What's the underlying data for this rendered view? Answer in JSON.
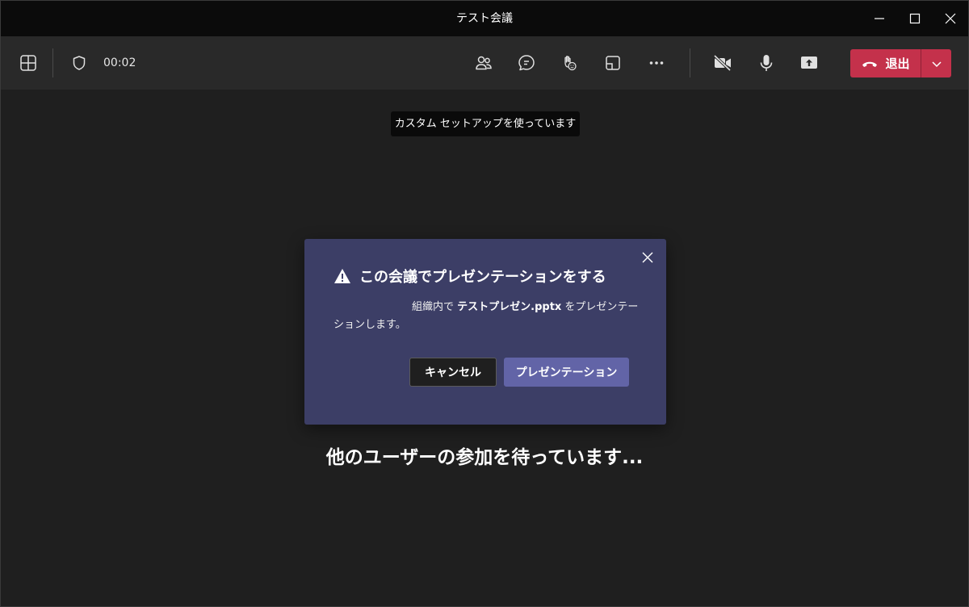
{
  "window": {
    "title": "テスト会議"
  },
  "toolbar": {
    "timer": "00:02",
    "leave_label": "退出"
  },
  "tooltip": {
    "text": "カスタム セットアップを使っています"
  },
  "dialog": {
    "title": "この会議でプレゼンテーションをする",
    "body_prefix": "組織内で ",
    "file_name": "テストプレゼン.pptx",
    "body_suffix": " をプレゼンテーションします。",
    "cancel_label": "キャンセル",
    "present_label": "プレゼンテーション"
  },
  "stage": {
    "waiting_text": "他のユーザーの参加を待っています..."
  },
  "colors": {
    "leave": "#c4314b",
    "primary": "#6264a7",
    "dialog_bg": "#3c3e66",
    "toolbar_bg": "#292929",
    "stage_bg": "#1f1f1f"
  },
  "icons": [
    "layout-grid-icon",
    "shield-icon",
    "people-icon",
    "chat-icon",
    "raise-hand-icon",
    "rooms-icon",
    "more-icon",
    "camera-off-icon",
    "microphone-icon",
    "share-screen-icon",
    "phone-hangup-icon",
    "chevron-down-icon",
    "warning-icon",
    "close-icon",
    "minimize-icon",
    "maximize-icon",
    "window-close-icon"
  ]
}
